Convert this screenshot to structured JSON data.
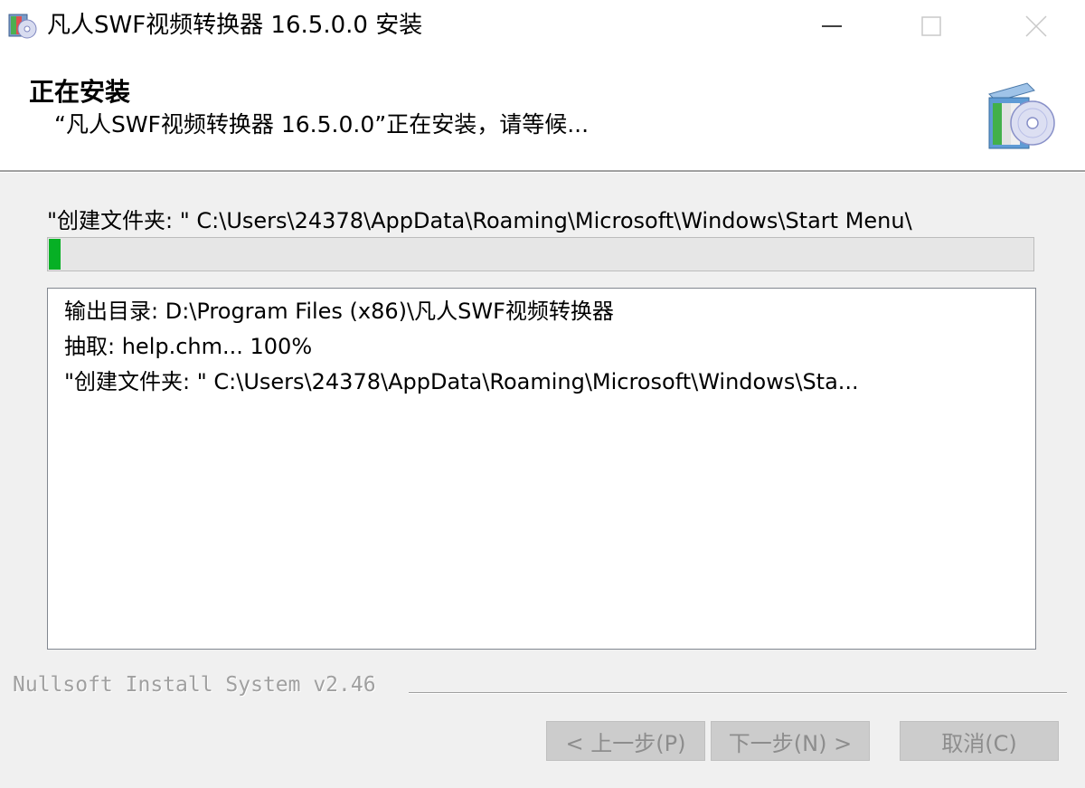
{
  "window": {
    "title": "凡人SWF视频转换器 16.5.0.0 安装"
  },
  "header": {
    "title": "正在安装",
    "subtitle": "“凡人SWF视频转换器 16.5.0.0”正在安装，请等候..."
  },
  "status": {
    "current_action": "\"创建文件夹: \" C:\\Users\\24378\\AppData\\Roaming\\Microsoft\\Windows\\Start Menu\\"
  },
  "progress": {
    "fraction": 0.012,
    "color": "#06b025"
  },
  "log": {
    "lines": [
      "输出目录: D:\\Program Files (x86)\\凡人SWF视频转换器",
      "抽取: help.chm... 100%",
      "\"创建文件夹: \" C:\\Users\\24378\\AppData\\Roaming\\Microsoft\\Windows\\Sta..."
    ]
  },
  "footer": {
    "branding": "Nullsoft Install System v2.46"
  },
  "buttons": {
    "back": "< 上一步(P)",
    "next": "下一步(N) >",
    "cancel": "取消(C)"
  }
}
